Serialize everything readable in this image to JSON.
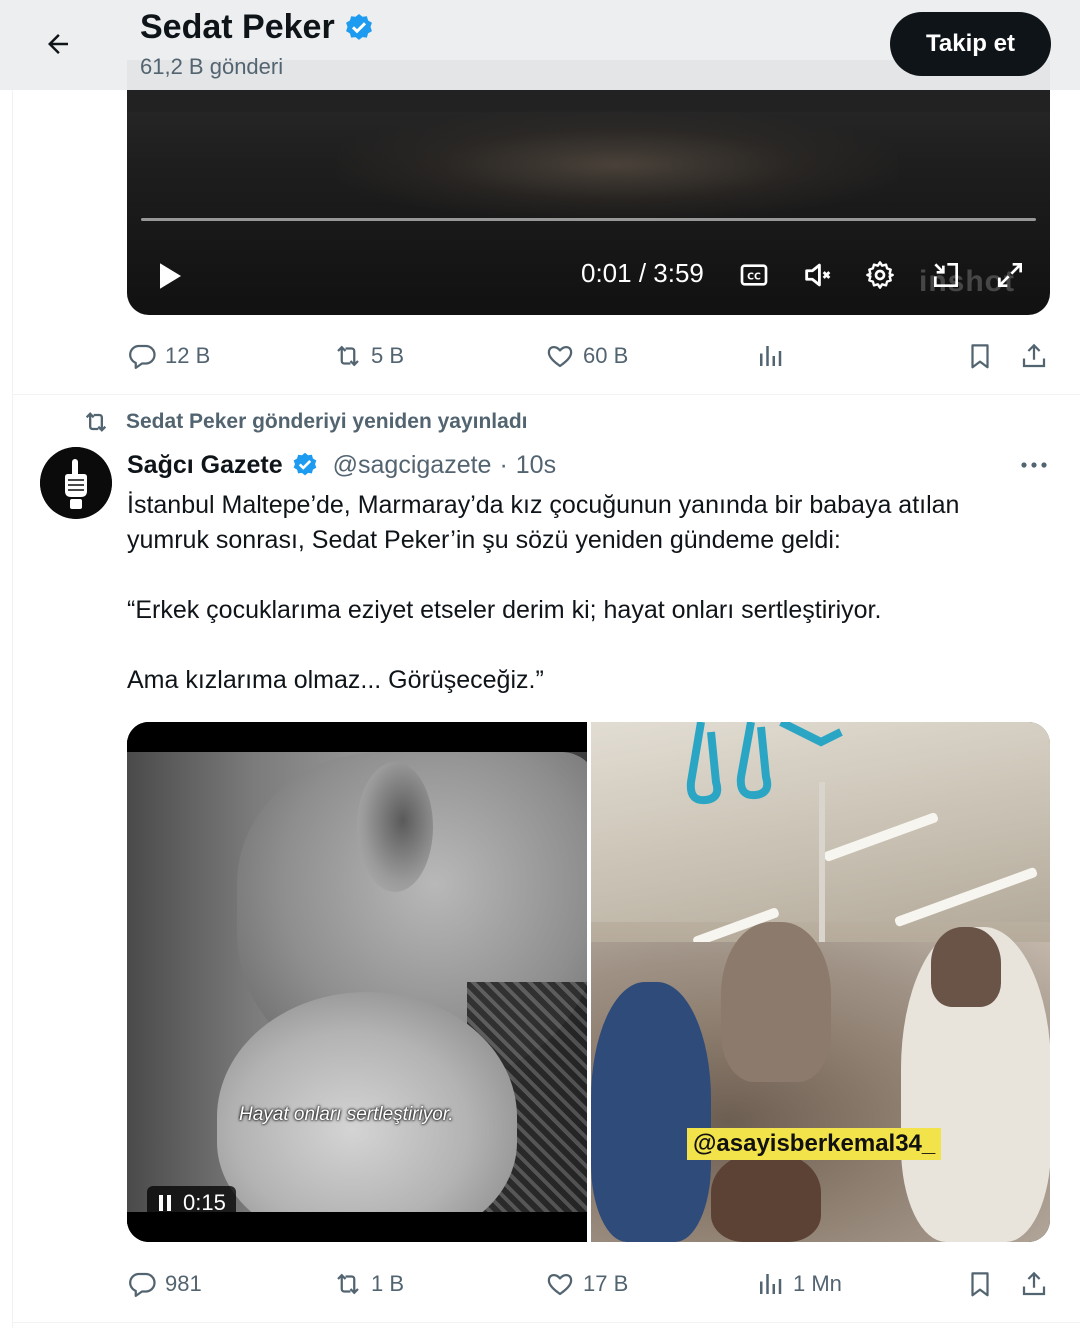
{
  "header": {
    "title": "Sedat Peker",
    "post_count": "61,2 B gönderi",
    "follow_label": "Takip et"
  },
  "video1": {
    "time": "0:01 / 3:59",
    "watermark": "inshot"
  },
  "tweet1_actions": {
    "replies": "12 B",
    "reposts": "5 B",
    "likes": "60 B",
    "views": ""
  },
  "tweet2": {
    "repost_note": "Sedat Peker gönderiyi yeniden yayınladı",
    "author_name": "Sağcı Gazete",
    "handle": "@sagcigazete",
    "separator": "·",
    "time": "10s",
    "text": {
      "line1": "İstanbul Maltepe’de, Marmaray’da kız çocuğunun yanında bir babaya atılan",
      "line2": "yumruk sonrası, Sedat Peker’in şu sözü yeniden gündeme geldi:",
      "quote1": "“Erkek çocuklarıma eziyet etseler derim ki; hayat onları sertleştiriyor.",
      "quote2": "Ama kızlarıma olmaz... Görüşeceğiz.”"
    },
    "media": {
      "subtitle": "Hayat onları sertleştiriyor.",
      "video_time": "0:15",
      "overlay_handle": "@asayisberkemal34_"
    },
    "actions": {
      "replies": "981",
      "reposts": "1 B",
      "likes": "17 B",
      "views": "1 Mn"
    }
  },
  "colors": {
    "text_primary": "#0f1419",
    "text_secondary": "#536471",
    "verified_blue": "#1d9bf0",
    "border": "#eff3f4"
  }
}
